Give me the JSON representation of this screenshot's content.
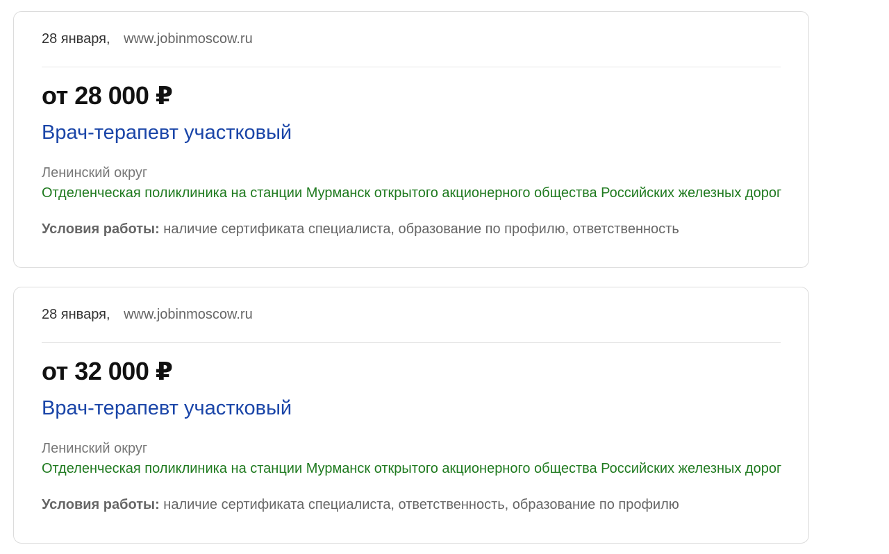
{
  "vacancies": [
    {
      "date": "28 января",
      "source": "www.jobinmoscow.ru",
      "salary": "от 28 000 ₽",
      "title": "Врач-терапевт участковый",
      "district": "Ленинский округ",
      "employer": "Отделенческая поликлиника на станции Мурманск открытого акционерного общества Российских железных дорог",
      "conditions_label": "Условия работы:",
      "conditions_text": "наличие сертификата специалиста, образование по профилю, ответственность"
    },
    {
      "date": "28 января",
      "source": "www.jobinmoscow.ru",
      "salary": "от 32 000 ₽",
      "title": "Врач-терапевт участковый",
      "district": "Ленинский округ",
      "employer": "Отделенческая поликлиника на станции Мурманск открытого акционерного общества Российских железных дорог",
      "conditions_label": "Условия работы:",
      "conditions_text": "наличие сертификата специалиста, ответственность, образование по профилю"
    }
  ],
  "separator": ","
}
